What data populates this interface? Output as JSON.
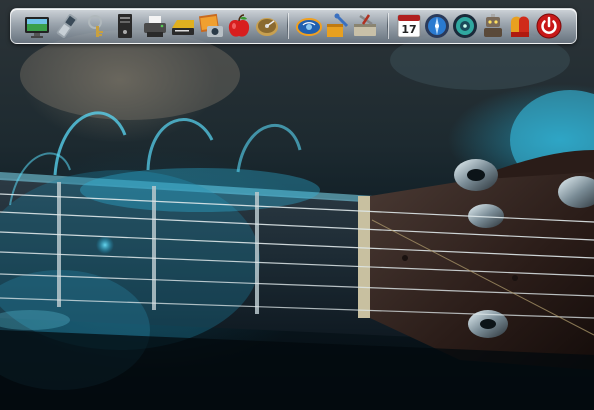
{
  "dock": {
    "calendar_day": "17",
    "items": [
      {
        "name": "display-icon"
      },
      {
        "name": "mobile-phone-icon"
      },
      {
        "name": "keychain-icon"
      },
      {
        "name": "tower-computer-icon"
      },
      {
        "name": "printer-icon"
      },
      {
        "name": "scanner-icon"
      },
      {
        "name": "photo-camera-icon"
      },
      {
        "name": "apple-icon"
      },
      {
        "name": "hard-drive-icon"
      },
      {
        "name": "globe-network-icon"
      },
      {
        "name": "package-tools-icon"
      },
      {
        "name": "toolbox-icon"
      },
      {
        "name": "calendar-icon"
      },
      {
        "name": "blue-disc-icon"
      },
      {
        "name": "media-disc-icon"
      },
      {
        "name": "robot-icon"
      },
      {
        "name": "boxing-glove-icon"
      },
      {
        "name": "power-icon"
      }
    ]
  },
  "colors": {
    "accent_cyan": "#27c6ea",
    "headstock": "#3a2a24",
    "dock_glass": "#c4ccd4"
  }
}
